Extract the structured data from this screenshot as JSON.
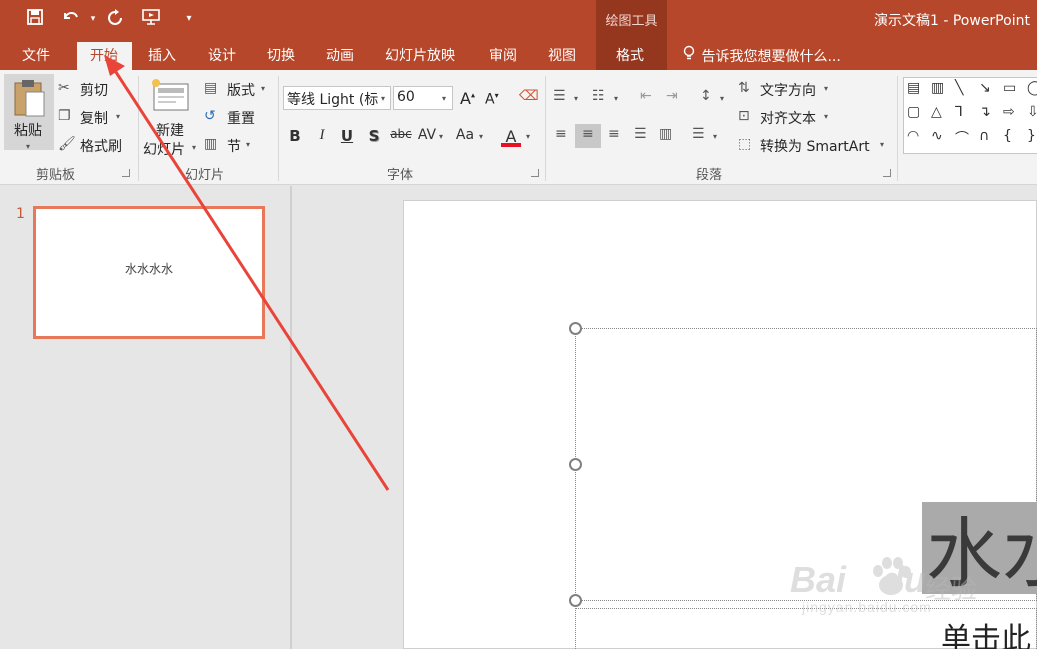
{
  "window": {
    "title": "演示文稿1 - PowerPoint",
    "contextual_tab_group": "绘图工具"
  },
  "quick_access": {
    "save_icon": "save-icon",
    "undo_icon": "undo-icon",
    "redo_icon": "repeat-icon",
    "presenter_icon": "start-slideshow-icon",
    "customize_icon": "customize-qat-icon"
  },
  "tabs": {
    "file": "文件",
    "home": "开始",
    "insert": "插入",
    "design": "设计",
    "transitions": "切换",
    "animations": "动画",
    "slideshow": "幻灯片放映",
    "review": "审阅",
    "view": "视图",
    "format": "格式",
    "tell_me": "告诉我您想要做什么..."
  },
  "ribbon": {
    "clipboard": {
      "paste": "粘贴",
      "cut": "剪切",
      "copy": "复制",
      "format_painter": "格式刷",
      "group_label": "剪贴板"
    },
    "slides": {
      "new_slide_line1": "新建",
      "new_slide_line2": "幻灯片",
      "layout": "版式",
      "reset": "重置",
      "section": "节",
      "group_label": "幻灯片"
    },
    "font": {
      "font_name": "等线 Light (标",
      "font_size": "60",
      "bold": "B",
      "italic": "I",
      "underline": "U",
      "shadow": "S",
      "strike": "abc",
      "spacing": "AV",
      "change_case": "Aa",
      "font_color": "A",
      "font_color_hex": "#e81123",
      "group_label": "字体"
    },
    "paragraph": {
      "text_direction": "文字方向",
      "align_text": "对齐文本",
      "smartart": "转换为 SmartArt",
      "group_label": "段落"
    }
  },
  "slide_panel": {
    "thumbnail_number": "1",
    "thumbnail_text": "水水水水"
  },
  "slide": {
    "title_text": "水水",
    "subtitle_placeholder": "单击此"
  },
  "watermark": {
    "brand": "Bai",
    "brand2": "du",
    "cn": "经验",
    "url": "jingyan.baidu.com"
  },
  "colors": {
    "accent": "#b7472a",
    "accent_dark": "#95361f",
    "annotation_arrow": "#e8443a"
  }
}
